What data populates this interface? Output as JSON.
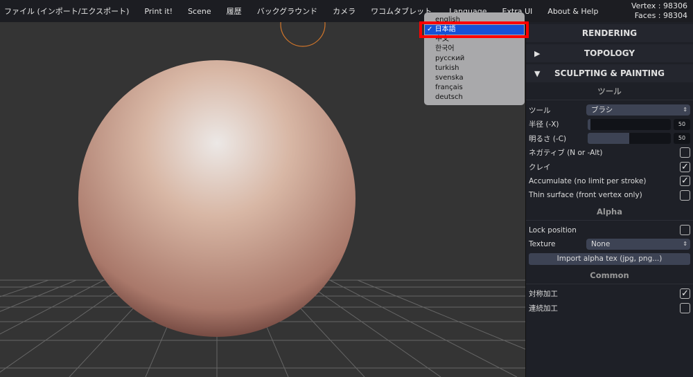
{
  "menubar": {
    "items": [
      "ファイル (インポート/エクスポート)",
      "Print it!",
      "Scene",
      "履歴",
      "バックグラウンド",
      "カメラ",
      "ワコムタブレット",
      "Language",
      "Extra UI",
      "About & Help"
    ]
  },
  "stats": {
    "vertex": "Vertex : 98306",
    "faces": "Faces : 98304"
  },
  "language_menu": {
    "options": [
      "english",
      "日本語",
      "中文",
      "한국어",
      "русский",
      "turkish",
      "svenska",
      "français",
      "deutsch"
    ],
    "selected": "日本語",
    "check": "✓"
  },
  "panel": {
    "sections": {
      "rendering": "RENDERING",
      "topology": "TOPOLOGY",
      "sculpting": "SCULPTING & PAINTING"
    },
    "tool_header": "ツール",
    "tool_label": "ツール",
    "tool_value": "ブラシ",
    "radius_label": "半径 (-X)",
    "radius_value": "50",
    "radius_fill_percent": 3,
    "intensity_label": "明るさ (-C)",
    "intensity_value": "50",
    "intensity_fill_percent": 50,
    "negative_label": "ネガティブ (N or -Alt)",
    "negative_checked": false,
    "clay_label": "クレイ",
    "clay_checked": true,
    "accumulate_label": "Accumulate (no limit per stroke)",
    "accumulate_checked": true,
    "thin_label": "Thin surface (front vertex only)",
    "thin_checked": false,
    "alpha_header": "Alpha",
    "lock_label": "Lock position",
    "lock_checked": false,
    "texture_label": "Texture",
    "texture_value": "None",
    "import_button": "Import alpha tex (jpg, png...)",
    "common_header": "Common",
    "symmetry_label": "対称加工",
    "symmetry_checked": true,
    "continuous_label": "連続加工",
    "continuous_checked": false
  },
  "colors": {
    "highlight": "#ff0000",
    "selected": "#1552d6",
    "cursor": "#d2762a"
  }
}
